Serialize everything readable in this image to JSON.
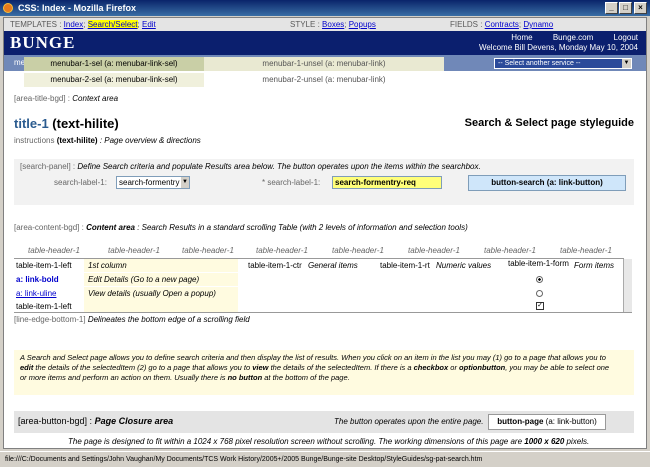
{
  "window": {
    "title": "CSS: Index - Mozilla Firefox"
  },
  "tplbar": {
    "templates_label": "TEMPLATES :",
    "index": "Index",
    "sep": ";",
    "search": "Search/Select",
    "sep2": ";",
    "edit": "Edit",
    "style_label": "STYLE :",
    "boxes": "Boxes",
    "popups": "Popups",
    "fields_label": "FIELDS :",
    "contracts": "Contracts",
    "dynamo": "Dynamo"
  },
  "header": {
    "logo": "BUNGE",
    "home": "Home",
    "bunge_com": "Bunge.com",
    "logout": "Logout",
    "welcome": "Welcome Bill Devens, Monday May 10, 2004"
  },
  "section": {
    "label": "menubar-section",
    "service_select": "-- Select another service --"
  },
  "menu1": {
    "sel": "menubar-1-sel (a: menubar-link-sel)",
    "unsel": "menubar-1-unsel (a: menubar-link)"
  },
  "menu2": {
    "sel": "menubar-2-sel (a: menubar-link-sel)",
    "unsel": "menubar-2-unsel (a: menubar-link)"
  },
  "titlearea": {
    "code": "[area-title-bgd] :",
    "desc": "Context area"
  },
  "title": {
    "main": "title-1",
    "hilite": "(text-hilite)",
    "page": "Search & Select page styleguide"
  },
  "instructions": {
    "label": "instructions",
    "hilite": "(text-hilite)",
    "desc": ": Page overview & directions"
  },
  "search": {
    "code": "[search-panel] :",
    "desc": "Define Search criteria and populate Results area below. The button operates upon the items within the searchbox.",
    "label1": "search-label-1:",
    "value1": "search-formentry",
    "label2": "* search-label-1:",
    "value2": "search-formentry-req",
    "button": "button-search (a: link-button)"
  },
  "content": {
    "code": "[area-content-bgd] :",
    "bold": "Content area",
    "desc": ": Search Results in a standard scrolling Table (with 2 levels of information and selection tools)"
  },
  "table": {
    "headers": [
      "table-header-1",
      "table-header-1",
      "table-header-1",
      "table-header-1",
      "table-header-1",
      "table-header-1",
      "table-header-1",
      "table-header-1"
    ],
    "rows": [
      {
        "c1": "table-item-1-left",
        "c2": "1st column",
        "c3": "table-item-1-ctr",
        "c4": "General items",
        "c5": "table-item-1-rt",
        "c6": "Numeric values",
        "c7": "table-item-1-form",
        "c8": "Form items"
      },
      {
        "c1": "a: link-bold",
        "c2": "Edit Details (Go to a new page)"
      },
      {
        "c1": "a: link-uline",
        "c2": "View details (usually Open a popup)"
      },
      {
        "c1": "table-item-1-left",
        "c2": ""
      }
    ]
  },
  "edge": {
    "code": "[line-edge-bottom-1]",
    "desc": "Delineates the bottom edge of a scrolling field"
  },
  "info": {
    "p1": "A Search and Select page allows you to define search criteria and then display the list of results. When you click on an item in the list you may (1) go to a page that allows you to",
    "p2a": "edit",
    "p2b": " the details of the selectedItem (2) go to a page that allows you to ",
    "p2c": "view",
    "p2d": " the details of the selectedItem. If there is a ",
    "p2e": "checkbox",
    "p2f": " or ",
    "p2g": "optionbutton",
    "p2h": ", you may be able to select one",
    "p3a": "or more items and perform an action on them. Usually there is ",
    "p3b": "no button",
    "p3c": " at the bottom of the page."
  },
  "buttonarea": {
    "code": "[area-button-bgd] :",
    "desc": "Page Closure area",
    "note": "The button operates upon the entire page.",
    "button": "button-page",
    "button_sub": "(a: link-button)"
  },
  "footer": {
    "note_a": "The page is designed to fit within a 1024 x 768 pixel resolution screen without scrolling. The working dimensions of this page are ",
    "note_b": "1000 x 620",
    "note_c": " pixels."
  },
  "status": {
    "text": "file:///C:/Documents and Settings/John Vaughan/My Documents/TCS Work History/2005+/2005 Bunge/Bunge-site Desktop/StyleGuides/sg-pat-search.htm"
  }
}
